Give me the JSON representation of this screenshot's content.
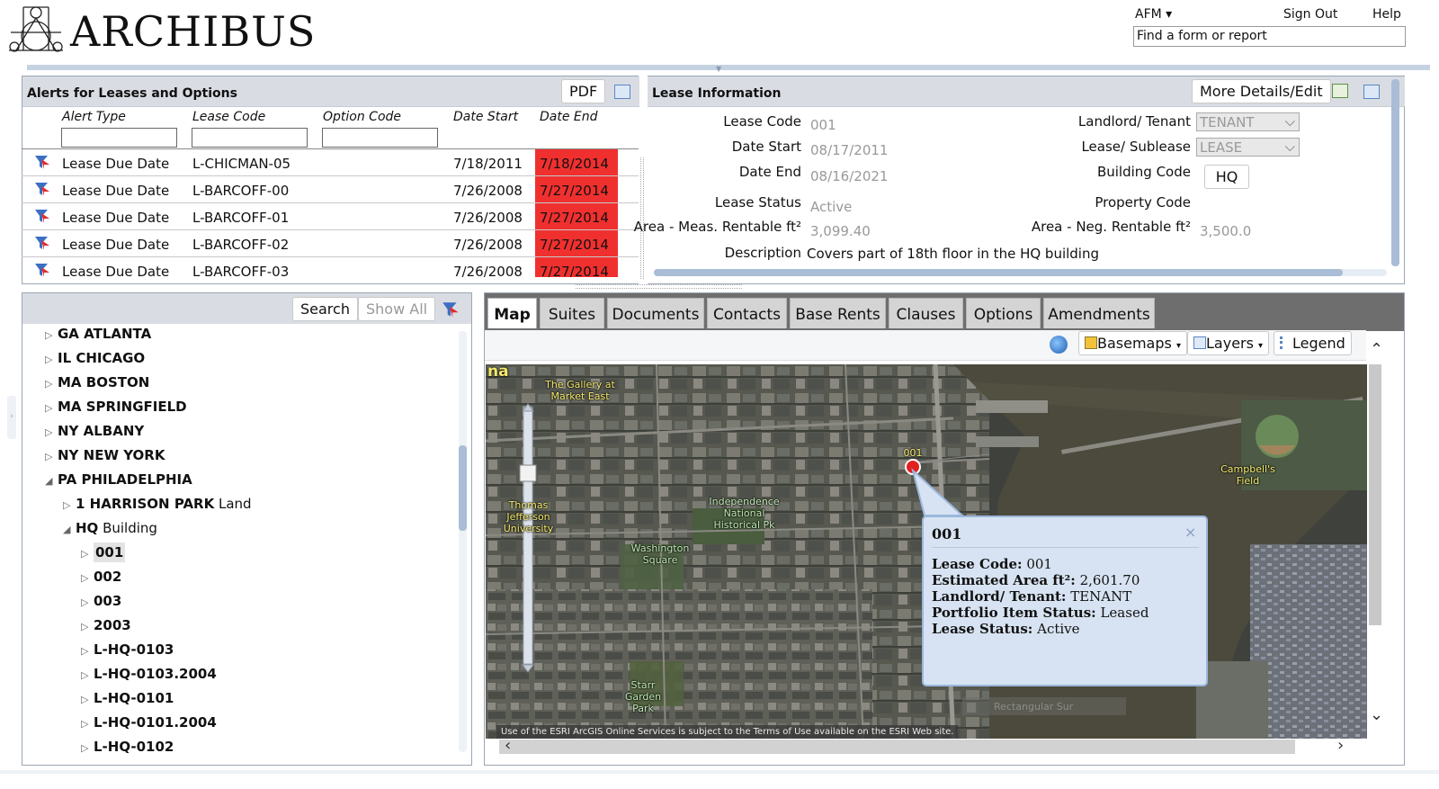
{
  "header": {
    "logo_text": "ARCHIBUS",
    "afm_label": "AFM ▾",
    "sign_out": "Sign Out",
    "help": "Help",
    "find_value": "Find a form or report"
  },
  "alerts_panel": {
    "title": "Alerts for Leases and Options",
    "pdf_label": "PDF",
    "columns": [
      "Alert Type",
      "Lease Code",
      "Option Code",
      "Date Start",
      "Date End"
    ],
    "rows": [
      {
        "alert_type": "Lease Due Date",
        "lease_code": "L-CHICMAN-05",
        "option_code": "",
        "date_start": "7/18/2011",
        "date_end": "7/18/2014"
      },
      {
        "alert_type": "Lease Due Date",
        "lease_code": "L-BARCOFF-00",
        "option_code": "",
        "date_start": "7/26/2008",
        "date_end": "7/27/2014"
      },
      {
        "alert_type": "Lease Due Date",
        "lease_code": "L-BARCOFF-01",
        "option_code": "",
        "date_start": "7/26/2008",
        "date_end": "7/27/2014"
      },
      {
        "alert_type": "Lease Due Date",
        "lease_code": "L-BARCOFF-02",
        "option_code": "",
        "date_start": "7/26/2008",
        "date_end": "7/27/2014"
      },
      {
        "alert_type": "Lease Due Date",
        "lease_code": "L-BARCOFF-03",
        "option_code": "",
        "date_start": "7/26/2008",
        "date_end": "7/27/2014"
      }
    ],
    "highlight_color": "#f0302f"
  },
  "lease_info": {
    "title": "Lease Information",
    "more_details_label": "More Details/Edit",
    "fields": {
      "lease_code": {
        "label": "Lease Code",
        "value": "001"
      },
      "date_start": {
        "label": "Date Start",
        "value": "08/17/2011"
      },
      "date_end": {
        "label": "Date End",
        "value": "08/16/2021"
      },
      "lease_status": {
        "label": "Lease Status",
        "value": "Active"
      },
      "area_meas": {
        "label": "Area - Meas. Rentable ft²",
        "value": "3,099.40"
      },
      "description": {
        "label": "Description",
        "value": "Covers part of 18th floor in the HQ building"
      },
      "landlord_tenant": {
        "label": "Landlord/ Tenant",
        "value": "TENANT"
      },
      "lease_sublease": {
        "label": "Lease/ Sublease",
        "value": "LEASE"
      },
      "building_code": {
        "label": "Building Code",
        "value": "HQ"
      },
      "property_code": {
        "label": "Property Code",
        "value": ""
      },
      "area_neg": {
        "label": "Area - Neg. Rentable ft²",
        "value": "3,500.0"
      }
    }
  },
  "tree_panel": {
    "search_label": "Search",
    "show_all_label": "Show All",
    "items": [
      {
        "code": "GA ATLANTA",
        "suffix": "",
        "level": 0,
        "expanded": false
      },
      {
        "code": "IL CHICAGO",
        "suffix": "",
        "level": 0,
        "expanded": false
      },
      {
        "code": "MA BOSTON",
        "suffix": "",
        "level": 0,
        "expanded": false
      },
      {
        "code": "MA SPRINGFIELD",
        "suffix": "",
        "level": 0,
        "expanded": false
      },
      {
        "code": "NY ALBANY",
        "suffix": "",
        "level": 0,
        "expanded": false
      },
      {
        "code": "NY NEW YORK",
        "suffix": "",
        "level": 0,
        "expanded": false
      },
      {
        "code": "PA PHILADELPHIA",
        "suffix": "",
        "level": 0,
        "expanded": true
      },
      {
        "code": "1 HARRISON PARK",
        "suffix": " Land",
        "level": 1,
        "expanded": false
      },
      {
        "code": "HQ",
        "suffix": " Building",
        "level": 1,
        "expanded": true
      },
      {
        "code": "001",
        "suffix": "",
        "level": 2,
        "expanded": false,
        "selected": true
      },
      {
        "code": "002",
        "suffix": "",
        "level": 2,
        "expanded": false
      },
      {
        "code": "003",
        "suffix": "",
        "level": 2,
        "expanded": false
      },
      {
        "code": "2003",
        "suffix": "",
        "level": 2,
        "expanded": false
      },
      {
        "code": "L-HQ-0103",
        "suffix": "",
        "level": 2,
        "expanded": false
      },
      {
        "code": "L-HQ-0103.2004",
        "suffix": "",
        "level": 2,
        "expanded": false
      },
      {
        "code": "L-HQ-0101",
        "suffix": "",
        "level": 2,
        "expanded": false
      },
      {
        "code": "L-HQ-0101.2004",
        "suffix": "",
        "level": 2,
        "expanded": false
      },
      {
        "code": "L-HQ-0102",
        "suffix": "",
        "level": 2,
        "expanded": false
      }
    ]
  },
  "tabs": [
    "Map",
    "Suites",
    "Documents",
    "Contacts",
    "Base Rents",
    "Clauses",
    "Options",
    "Amendments"
  ],
  "active_tab": "Map",
  "map_toolbar": {
    "basemaps_label": "Basemaps",
    "layers_label": "Layers",
    "legend_label": "Legend"
  },
  "map": {
    "labels": {
      "gallery": "The Gallery at\nMarket East",
      "jefferson": "Thomas\nJefferson\nUniversity",
      "independence": "Independence\nNational\nHistorical Pk",
      "washington": "Washington\nSquare",
      "campbells": "Campbell's\nField",
      "starr": "Starr\nGarden\nPark",
      "corner": "na",
      "marker": "001"
    },
    "attribution": "Use of the ESRI ArcGIS Online Services is subject to the Terms of Use available on the ESRI Web site.",
    "faint_label": "Rectangular Sur"
  },
  "popup": {
    "title": "001",
    "close": "×",
    "lines": [
      {
        "label": "Lease Code:",
        "value": "001"
      },
      {
        "label": "Estimated Area ft²:",
        "value": "2,601.70"
      },
      {
        "label": "Landlord/ Tenant:",
        "value": "TENANT"
      },
      {
        "label": "Portfolio Item Status:",
        "value": "Leased"
      },
      {
        "label": "Lease Status:",
        "value": "Active"
      }
    ]
  }
}
